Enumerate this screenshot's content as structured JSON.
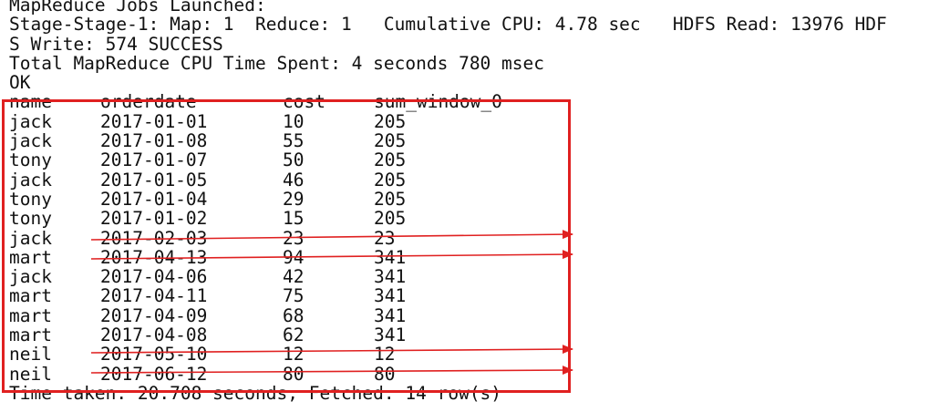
{
  "header_lines": [
    "MapReduce Jobs Launched:",
    "Stage-Stage-1: Map: 1  Reduce: 1   Cumulative CPU: 4.78 sec   HDFS Read: 13976 HDF",
    "S Write: 574 SUCCESS",
    "Total MapReduce CPU Time Spent: 4 seconds 780 msec",
    "OK"
  ],
  "table": {
    "columns": [
      "name",
      "orderdate",
      "cost",
      "sum_window_0"
    ],
    "rows": [
      [
        "jack",
        "2017-01-01",
        "10",
        "205"
      ],
      [
        "jack",
        "2017-01-08",
        "55",
        "205"
      ],
      [
        "tony",
        "2017-01-07",
        "50",
        "205"
      ],
      [
        "jack",
        "2017-01-05",
        "46",
        "205"
      ],
      [
        "tony",
        "2017-01-04",
        "29",
        "205"
      ],
      [
        "tony",
        "2017-01-02",
        "15",
        "205"
      ],
      [
        "jack",
        "2017-02-03",
        "23",
        "23"
      ],
      [
        "mart",
        "2017-04-13",
        "94",
        "341"
      ],
      [
        "jack",
        "2017-04-06",
        "42",
        "341"
      ],
      [
        "mart",
        "2017-04-11",
        "75",
        "341"
      ],
      [
        "mart",
        "2017-04-09",
        "68",
        "341"
      ],
      [
        "mart",
        "2017-04-08",
        "62",
        "341"
      ],
      [
        "neil",
        "2017-05-10",
        "12",
        "12"
      ],
      [
        "neil",
        "2017-06-12",
        "80",
        "80"
      ]
    ]
  },
  "footer_line": "Time taken: 20.708 seconds, Fetched: 14 row(s)",
  "colors": {
    "annotation_red": "#e02020",
    "text": "#111111",
    "background": "#ffffff"
  }
}
